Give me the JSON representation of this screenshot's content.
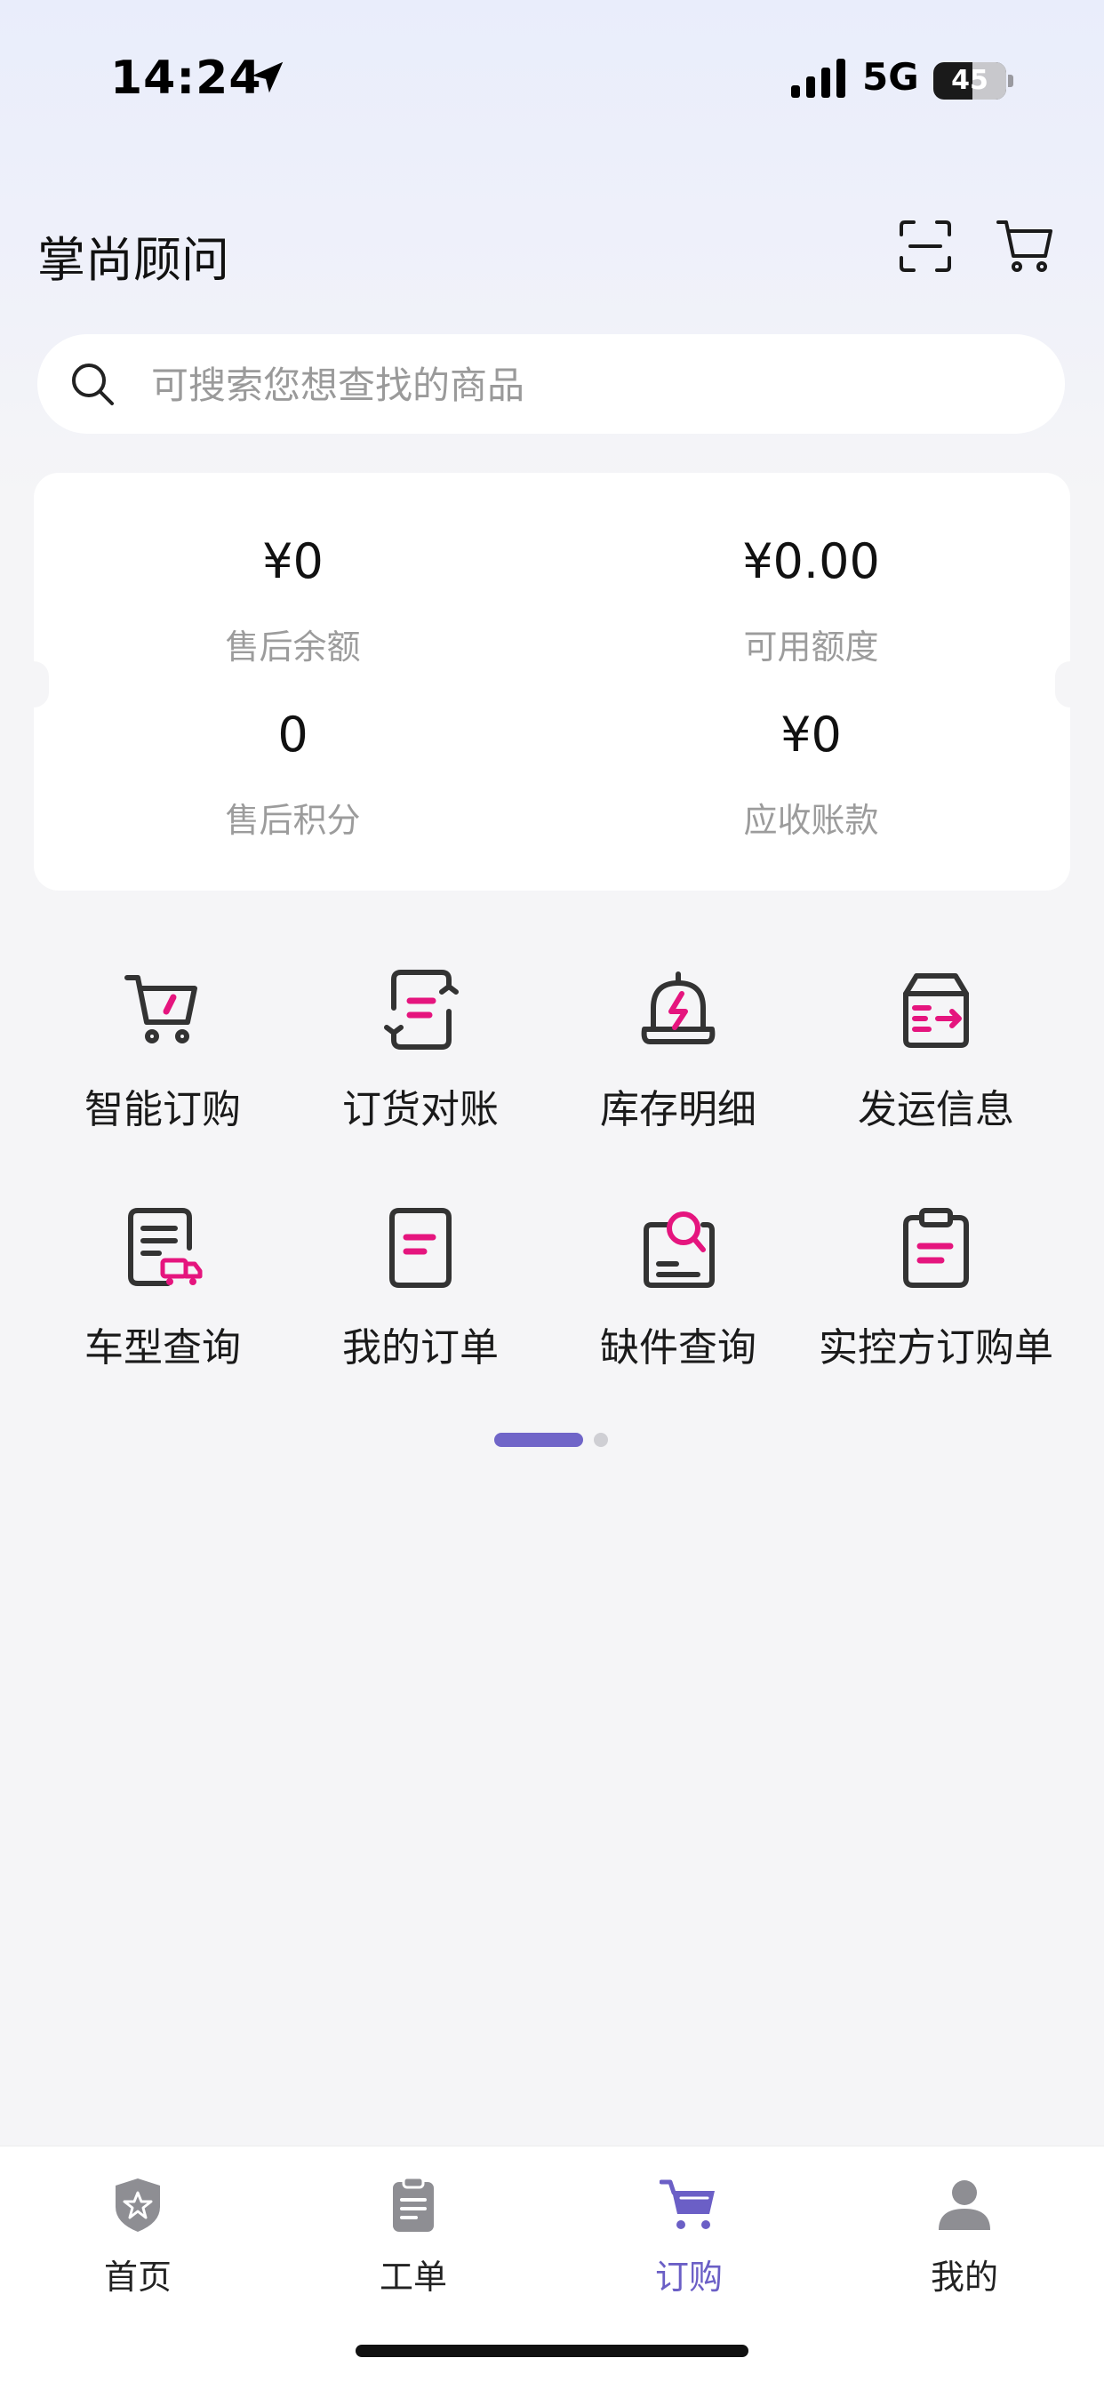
{
  "status_bar": {
    "time": "14:24",
    "network": "5G",
    "battery": "45"
  },
  "header": {
    "title": "掌尚顾问",
    "scan_icon": "scan-icon",
    "cart_icon": "cart-icon"
  },
  "search": {
    "placeholder": "可搜索您想查找的商品",
    "value": ""
  },
  "balances": [
    {
      "value": "¥0",
      "label": "售后余额"
    },
    {
      "value": "¥0.00",
      "label": "可用额度"
    },
    {
      "value": "0",
      "label": "售后积分"
    },
    {
      "value": "¥0",
      "label": "应收账款"
    }
  ],
  "quick_actions": [
    {
      "label": "智能订购",
      "icon": "smart-cart-icon"
    },
    {
      "label": "订货对账",
      "icon": "reconcile-icon"
    },
    {
      "label": "库存明细",
      "icon": "stock-bell-icon"
    },
    {
      "label": "发运信息",
      "icon": "shipping-box-icon"
    },
    {
      "label": "车型查询",
      "icon": "vehicle-doc-icon"
    },
    {
      "label": "我的订单",
      "icon": "order-doc-icon"
    },
    {
      "label": "缺件查询",
      "icon": "missing-search-icon"
    },
    {
      "label": "实控方订购单",
      "icon": "clipboard-icon"
    }
  ],
  "tabs": [
    {
      "label": "首页",
      "icon": "home-shield-icon",
      "active": false
    },
    {
      "label": "工单",
      "icon": "clipboard-list-icon",
      "active": false
    },
    {
      "label": "订购",
      "icon": "cart-icon",
      "active": true
    },
    {
      "label": "我的",
      "icon": "user-icon",
      "active": false
    }
  ],
  "colors": {
    "accent": "#e5157e",
    "tab_active": "#6b5fc6",
    "pager_active": "#7065c8"
  }
}
